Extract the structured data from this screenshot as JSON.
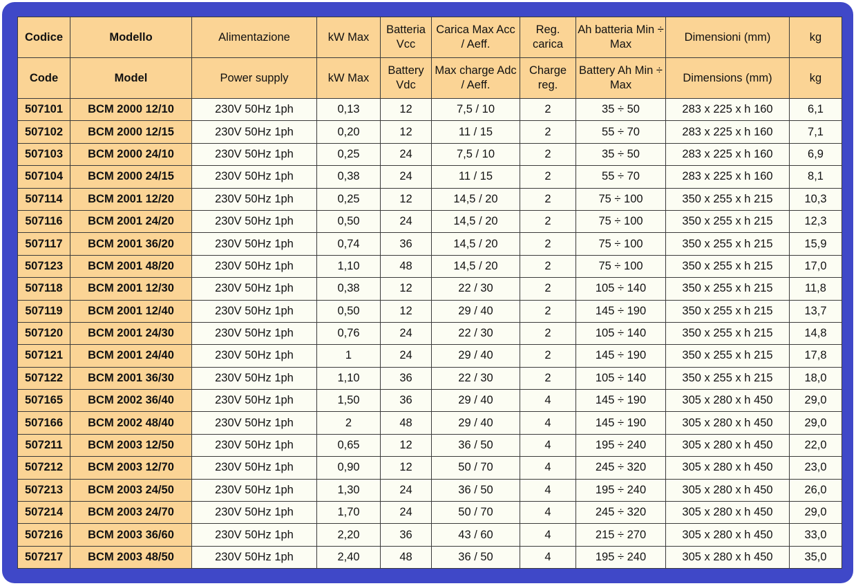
{
  "header_it": [
    "Codice",
    "Modello",
    "Alimentazione",
    "kW Max",
    "Batteria Vcc",
    "Carica Max Acc / Aeff.",
    "Reg. carica",
    "Ah batteria Min ÷ Max",
    "Dimensioni (mm)",
    "kg"
  ],
  "header_en": [
    "Code",
    "Model",
    "Power supply",
    "kW Max",
    "Battery Vdc",
    "Max charge Adc / Aeff.",
    "Charge reg.",
    "Battery Ah Min ÷ Max",
    "Dimensions (mm)",
    "kg"
  ],
  "rows": [
    [
      "507101",
      "BCM 2000 12/10",
      "230V 50Hz 1ph",
      "0,13",
      "12",
      "7,5 / 10",
      "2",
      "35 ÷ 50",
      "283 x 225 x h 160",
      "6,1"
    ],
    [
      "507102",
      "BCM 2000 12/15",
      "230V 50Hz 1ph",
      "0,20",
      "12",
      "11 / 15",
      "2",
      "55 ÷ 70",
      "283 x 225 x h 160",
      "7,1"
    ],
    [
      "507103",
      "BCM 2000 24/10",
      "230V 50Hz 1ph",
      "0,25",
      "24",
      "7,5 / 10",
      "2",
      "35 ÷ 50",
      "283 x 225 x h 160",
      "6,9"
    ],
    [
      "507104",
      "BCM 2000 24/15",
      "230V 50Hz 1ph",
      "0,38",
      "24",
      "11 / 15",
      "2",
      "55 ÷ 70",
      "283 x 225 x h 160",
      "8,1"
    ],
    [
      "507114",
      "BCM 2001 12/20",
      "230V 50Hz 1ph",
      "0,25",
      "12",
      "14,5 / 20",
      "2",
      "75 ÷ 100",
      "350 x 255 x h 215",
      "10,3"
    ],
    [
      "507116",
      "BCM 2001 24/20",
      "230V 50Hz 1ph",
      "0,50",
      "24",
      "14,5 / 20",
      "2",
      "75 ÷ 100",
      "350 x 255 x h 215",
      "12,3"
    ],
    [
      "507117",
      "BCM 2001 36/20",
      "230V 50Hz 1ph",
      "0,74",
      "36",
      "14,5 / 20",
      "2",
      "75 ÷ 100",
      "350 x 255 x h 215",
      "15,9"
    ],
    [
      "507123",
      "BCM 2001 48/20",
      "230V 50Hz 1ph",
      "1,10",
      "48",
      "14,5 / 20",
      "2",
      "75 ÷ 100",
      "350 x 255 x h 215",
      "17,0"
    ],
    [
      "507118",
      "BCM 2001 12/30",
      "230V 50Hz 1ph",
      "0,38",
      "12",
      "22 / 30",
      "2",
      "105 ÷ 140",
      "350 x 255 x h 215",
      "11,8"
    ],
    [
      "507119",
      "BCM 2001 12/40",
      "230V 50Hz 1ph",
      "0,50",
      "12",
      "29 / 40",
      "2",
      "145 ÷ 190",
      "350 x 255 x h 215",
      "13,7"
    ],
    [
      "507120",
      "BCM 2001 24/30",
      "230V 50Hz 1ph",
      "0,76",
      "24",
      "22 / 30",
      "2",
      "105 ÷ 140",
      "350 x 255 x h 215",
      "14,8"
    ],
    [
      "507121",
      "BCM 2001 24/40",
      "230V 50Hz 1ph",
      "1",
      "24",
      "29 / 40",
      "2",
      "145 ÷ 190",
      "350 x 255 x h 215",
      "17,8"
    ],
    [
      "507122",
      "BCM 2001 36/30",
      "230V 50Hz 1ph",
      "1,10",
      "36",
      "22 / 30",
      "2",
      "105 ÷ 140",
      "350 x 255 x h 215",
      "18,0"
    ],
    [
      "507165",
      "BCM 2002 36/40",
      "230V 50Hz 1ph",
      "1,50",
      "36",
      "29 / 40",
      "4",
      "145 ÷ 190",
      "305 x 280 x h 450",
      "29,0"
    ],
    [
      "507166",
      "BCM 2002 48/40",
      "230V 50Hz 1ph",
      "2",
      "48",
      "29 / 40",
      "4",
      "145 ÷ 190",
      "305 x 280 x h 450",
      "29,0"
    ],
    [
      "507211",
      "BCM 2003 12/50",
      "230V 50Hz 1ph",
      "0,65",
      "12",
      "36 / 50",
      "4",
      "195 ÷ 240",
      "305 x 280 x h 450",
      "22,0"
    ],
    [
      "507212",
      "BCM 2003 12/70",
      "230V 50Hz 1ph",
      "0,90",
      "12",
      "50 / 70",
      "4",
      "245 ÷ 320",
      "305 x 280 x h 450",
      "23,0"
    ],
    [
      "507213",
      "BCM 2003 24/50",
      "230V 50Hz 1ph",
      "1,30",
      "24",
      "36 / 50",
      "4",
      "195 ÷ 240",
      "305 x 280 x h 450",
      "26,0"
    ],
    [
      "507214",
      "BCM 2003 24/70",
      "230V 50Hz 1ph",
      "1,70",
      "24",
      "50 / 70",
      "4",
      "245 ÷ 320",
      "305 x 280 x h 450",
      "29,0"
    ],
    [
      "507216",
      "BCM 2003 36/60",
      "230V 50Hz 1ph",
      "2,20",
      "36",
      "43 / 60",
      "4",
      "215 ÷ 270",
      "305 x 280 x h 450",
      "33,0"
    ],
    [
      "507217",
      "BCM 2003 48/50",
      "230V 50Hz 1ph",
      "2,40",
      "48",
      "36 / 50",
      "4",
      "195 ÷ 240",
      "305 x 280 x h 450",
      "35,0"
    ]
  ]
}
